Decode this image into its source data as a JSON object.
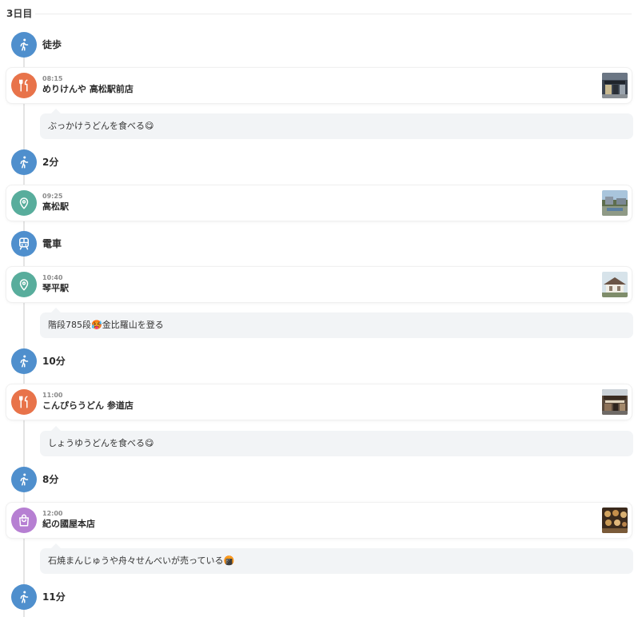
{
  "day": {
    "label": "3日目"
  },
  "timeline": [
    {
      "kind": "move",
      "mode": "walk",
      "icon": "walk-icon",
      "label": "徒歩"
    },
    {
      "kind": "place",
      "category": "food",
      "icon": "fork-knife-icon",
      "time": "08:15",
      "name": "めりけんや 高松駅前店",
      "photo": "udon-shop-storefront"
    },
    {
      "kind": "note",
      "text": "ぶっかけうどんを食べる😋"
    },
    {
      "kind": "move",
      "mode": "walk",
      "icon": "walk-icon",
      "label": "2分"
    },
    {
      "kind": "place",
      "category": "spot",
      "icon": "map-pin-icon",
      "time": "09:25",
      "name": "高松駅",
      "photo": "station-plaza"
    },
    {
      "kind": "move",
      "mode": "train",
      "icon": "train-icon",
      "label": "電車"
    },
    {
      "kind": "place",
      "category": "spot",
      "icon": "map-pin-icon",
      "time": "10:40",
      "name": "琴平駅",
      "photo": "station-building"
    },
    {
      "kind": "note",
      "text": "階段785段🥵金比羅山を登る"
    },
    {
      "kind": "move",
      "mode": "walk",
      "icon": "walk-icon",
      "label": "10分"
    },
    {
      "kind": "place",
      "category": "food",
      "icon": "fork-knife-icon",
      "time": "11:00",
      "name": "こんぴらうどん 参道店",
      "photo": "approach-shop"
    },
    {
      "kind": "note",
      "text": "しょうゆうどんを食べる😋"
    },
    {
      "kind": "move",
      "mode": "walk",
      "icon": "walk-icon",
      "label": "8分"
    },
    {
      "kind": "place",
      "category": "shop",
      "icon": "shopping-bag-icon",
      "time": "12:00",
      "name": "紀の國屋本店",
      "photo": "confectionery-display"
    },
    {
      "kind": "note",
      "text": "石焼まんじゅうや舟々せんべいが売っている🍘"
    },
    {
      "kind": "move",
      "mode": "walk",
      "icon": "walk-icon",
      "label": "11分"
    }
  ],
  "colors": {
    "move": "#4f8fcd",
    "food": "#e8734a",
    "spot": "#58ad9c",
    "shop": "#b67fd2",
    "note_bg": "#f2f4f6"
  }
}
